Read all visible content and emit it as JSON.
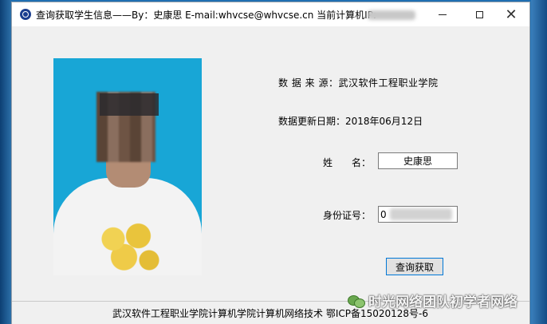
{
  "window": {
    "title": "查询获取学生信息——By：史康思 E-mail:whvcse@whvcse.cn 当前计算机IP:"
  },
  "controls": {
    "minimize": "—",
    "maximize": "□",
    "close": "✕"
  },
  "info": {
    "source_label": "数 据 来 源：武汉软件工程职业学院",
    "update_label": "数据更新日期：2018年06月12日",
    "name_label": "姓　　名：",
    "name_value": "史康思",
    "id_label": "身份证号：",
    "id_value": "0"
  },
  "actions": {
    "query_button": "查询获取"
  },
  "footer": {
    "text": "武汉软件工程职业学院计算机学院计算机网络技术  鄂ICP备15020128号-6"
  },
  "watermark": {
    "text": "时光网络团队初学者网络"
  },
  "icons": {
    "app": "app-icon",
    "photo": "student-photo",
    "watermark_logo": "wechat-icon"
  }
}
